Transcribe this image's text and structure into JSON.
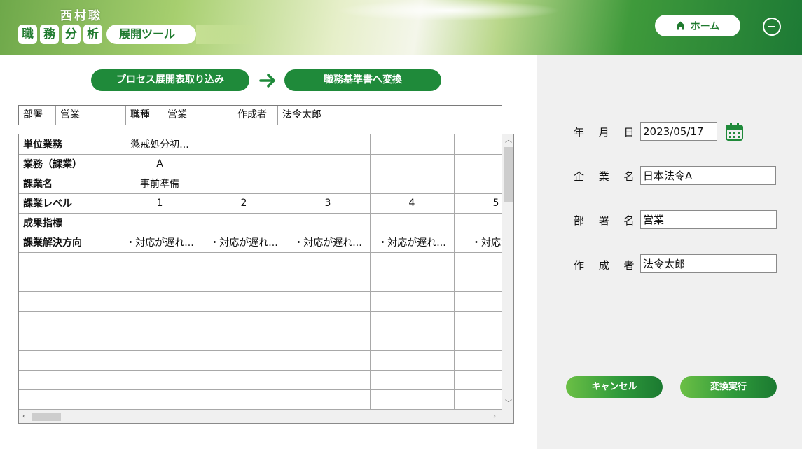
{
  "header": {
    "author": "西村聡",
    "title_chars": [
      "職",
      "務",
      "分",
      "析"
    ],
    "tool_label": "展開ツール",
    "home_label": "ホーム",
    "colors": {
      "brand_green": "#1f7a2e",
      "button_green": "#1f8a3a"
    }
  },
  "actions": {
    "import_label": "プロセス展開表取り込み",
    "convert_label": "職務基準書へ変換"
  },
  "info": {
    "dept_label": "部署",
    "dept_value": "営業",
    "job_label": "職種",
    "job_value": "営業",
    "author_label": "作成者",
    "author_value": "法令太郎"
  },
  "grid": {
    "row_headers": [
      "単位業務",
      "業務（課業）",
      "課業名",
      "課業レベル",
      "成果指標",
      "課業解決方向"
    ],
    "rows": [
      [
        "懲戒処分初...",
        "",
        "",
        "",
        ""
      ],
      [
        "A",
        "",
        "",
        "",
        ""
      ],
      [
        "事前準備",
        "",
        "",
        "",
        ""
      ],
      [
        "1",
        "2",
        "3",
        "4",
        "5"
      ],
      [
        "",
        "",
        "",
        "",
        ""
      ],
      [
        "・対応が遅れ...",
        "・対応が遅れ...",
        "・対応が遅れ...",
        "・対応が遅れ...",
        "・対応が遅"
      ]
    ]
  },
  "form": {
    "date_label": "年 月 日：",
    "date_value": "2023/05/17",
    "company_label": "企 業 名：",
    "company_value": "日本法令A",
    "dept_label": "部 署 名：",
    "dept_value": "営業",
    "author_label": "作 成 者：",
    "author_value": "法令太郎",
    "cancel_label": "キャンセル",
    "execute_label": "変換実行"
  }
}
